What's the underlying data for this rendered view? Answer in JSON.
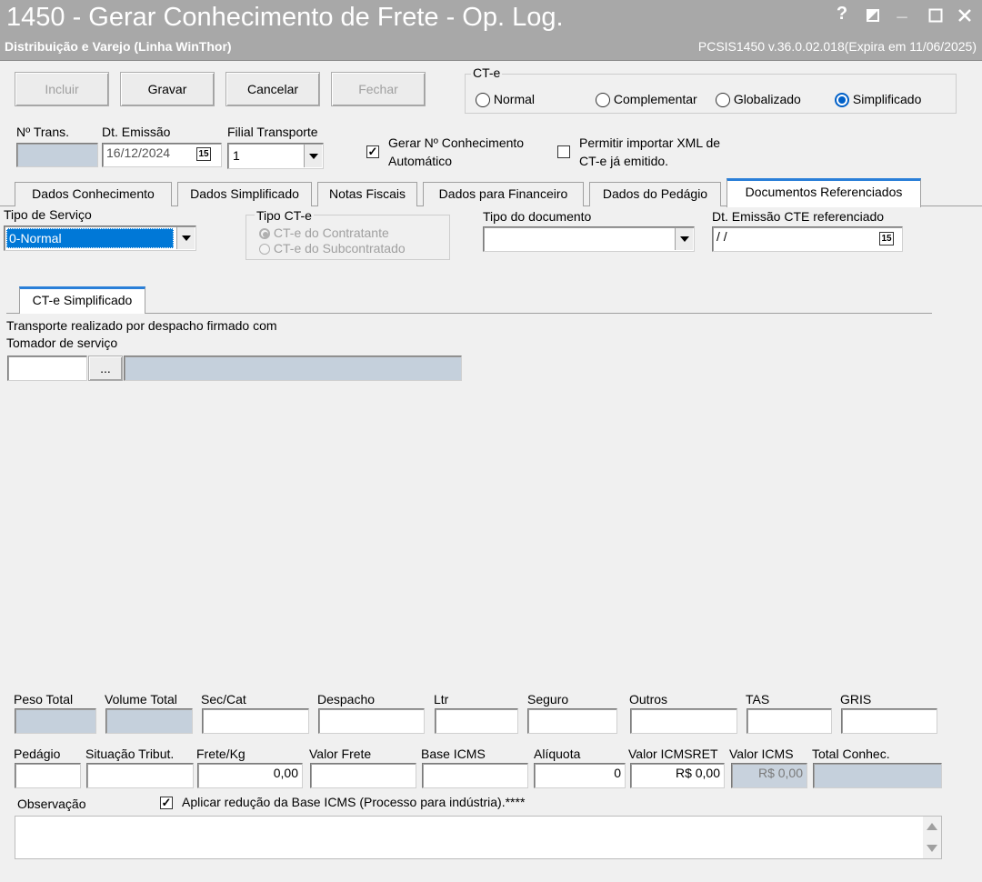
{
  "window": {
    "title": "1450 - Gerar Conhecimento de Frete - Op. Log.",
    "subtitle": "Distribuição e Varejo (Linha WinThor)",
    "version": "PCSIS1450  v.36.0.02.018(Expira em 11/06/2025)",
    "controls": {
      "help": "?",
      "minimize": "_"
    }
  },
  "toolbar": {
    "incluir": "Incluir",
    "gravar": "Gravar",
    "cancelar": "Cancelar",
    "fechar": "Fechar"
  },
  "cte_group": {
    "label": "CT-e",
    "options": [
      "Normal",
      "Complementar",
      "Globalizado",
      "Simplificado"
    ],
    "selected": "Simplificado"
  },
  "header_fields": {
    "ntrans_label": "Nº Trans.",
    "ntrans_value": "",
    "dt_emissao_label": "Dt. Emissão",
    "dt_emissao_value": "16/12/2024",
    "filial_label": "Filial Transporte",
    "filial_value": "1",
    "gerar_label_1": "Gerar Nº Conhecimento",
    "gerar_label_2": "Automático",
    "gerar_checked": true,
    "permitir_label_1": "Permitir importar XML de",
    "permitir_label_2": "CT-e já emitido.",
    "permitir_checked": false
  },
  "tabs": [
    "Dados Conhecimento",
    "Dados Simplificado",
    "Notas Fiscais",
    "Dados para Financeiro",
    "Dados do Pedágio",
    "Documentos Referenciados"
  ],
  "active_tab": "Documentos Referenciados",
  "docs_ref": {
    "tipo_servico_label": "Tipo de Serviço",
    "tipo_servico_value": "0-Normal",
    "tipo_cte_label": "Tipo CT-e",
    "tipo_cte_options": [
      "CT-e do Contratante",
      "CT-e do Subcontratado"
    ],
    "tipo_documento_label": "Tipo do documento",
    "tipo_documento_value": "",
    "dt_emissao_ref_label": "Dt. Emissão CTE referenciado",
    "dt_emissao_ref_value": " / /"
  },
  "subtab": {
    "label": "CT-e Simplificado",
    "transporte_line1": "Transporte realizado por despacho firmado com",
    "transporte_line2": "Tomador de serviço",
    "code_value": "",
    "ellipsis": "...",
    "desc_value": ""
  },
  "totals_row1": {
    "labels": [
      "Peso Total",
      "Volume Total",
      "Sec/Cat",
      "Despacho",
      "Ltr",
      "Seguro",
      "Outros",
      "TAS",
      "GRIS"
    ],
    "values": [
      "",
      "",
      "",
      "",
      "",
      "",
      "",
      "",
      ""
    ]
  },
  "totals_row2": {
    "labels": [
      "Pedágio",
      "Situação Tribut.",
      "Frete/Kg",
      "Valor Frete",
      "Base ICMS",
      "Alíquota",
      "Valor ICMSRET",
      "Valor ICMS",
      "Total Conhec."
    ],
    "values": [
      "",
      "",
      "0,00",
      "",
      "",
      "0",
      "R$ 0,00",
      "R$ 0,00",
      ""
    ]
  },
  "observacao": {
    "label": "Observação",
    "aplicar_label": "Aplicar redução da Base ICMS (Processo para indústria).****",
    "aplicar_checked": true,
    "value": ""
  },
  "colors": {
    "titlebar": "#a8a8a8",
    "readonly_field": "#c5d0dc",
    "selection": "#0078d7",
    "tab_accent": "#2a7fd8"
  }
}
